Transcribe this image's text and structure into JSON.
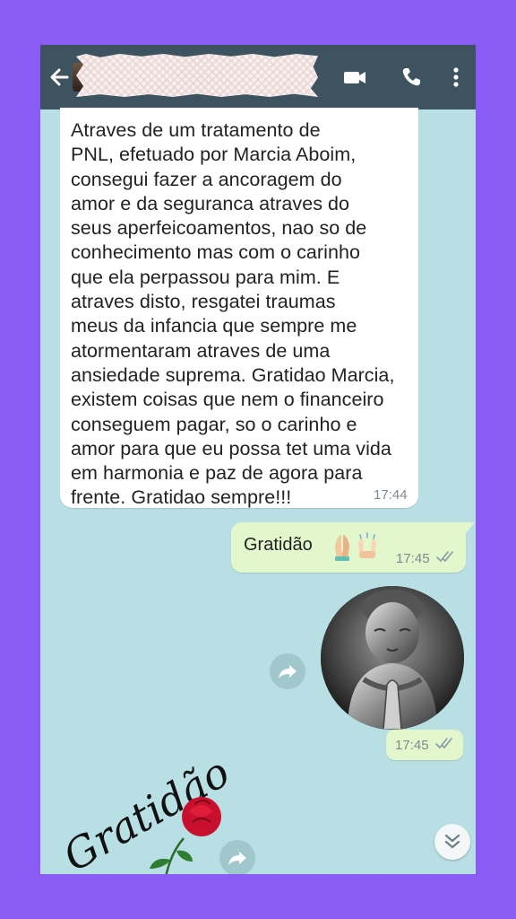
{
  "topbar": {
    "icons": [
      "back-arrow-icon",
      "video-call-icon",
      "phone-icon",
      "more-vertical-icon"
    ],
    "bg": "#3d5360"
  },
  "messages": {
    "incoming": {
      "text": "Atraves de um tratamento de PNL, efetuado por Marcia Aboim, consegui fazer a ancoragem do amor e da seguranca atraves do seus aperfeicoamentos, nao so de conhecimento mas com o carinho que ela perpassou para mim. E atraves disto, resgatei traumas meus da infancia que sempre me atormentaram atraves de uma ansiedade suprema. Gratidao Marcia, existem coisas que nem o financeiro conseguem pagar, so o carinho e amor para que eu possa tet uma vida em harmonia e paz de agora para frente. Gratidao sempre!!!",
      "lines": [
        "Atraves de um tratamento de",
        "PNL, efetuado por Marcia Aboim,",
        "consegui fazer a ancoragem do",
        "amor e da seguranca atraves do",
        "seus aperfeicoamentos, nao so de",
        "conhecimento mas com o carinho",
        "que ela perpassou para mim. E",
        "atraves disto, resgatei traumas",
        "meus da infancia que sempre me",
        "atormentaram atraves de uma",
        "ansiedade suprema. Gratidao Marcia,",
        "existem coisas que nem o financeiro",
        "conseguem pagar, so o carinho e",
        "amor para que eu possa tet uma vida",
        "em harmonia e paz de agora para",
        "frente. Gratidao sempre!!!"
      ],
      "time": "17:44"
    },
    "outgoing_text": {
      "text": "Gratidão",
      "emoji": "🙏🙌",
      "time": "17:45",
      "status_icon": "double-check-icon"
    },
    "outgoing_sticker": {
      "description_icon": "praying-buddha-sticker",
      "time": "17:45",
      "status_icon": "double-check-icon"
    },
    "incoming_sticker": {
      "text": "Gratidão",
      "icon": "red-rose-sticker"
    }
  },
  "colors": {
    "outer": "#8a5cf5",
    "chat_bg": "#b8dfe3",
    "outgoing_bubble": "#e2f7cb",
    "incoming_bubble": "#ffffff"
  }
}
